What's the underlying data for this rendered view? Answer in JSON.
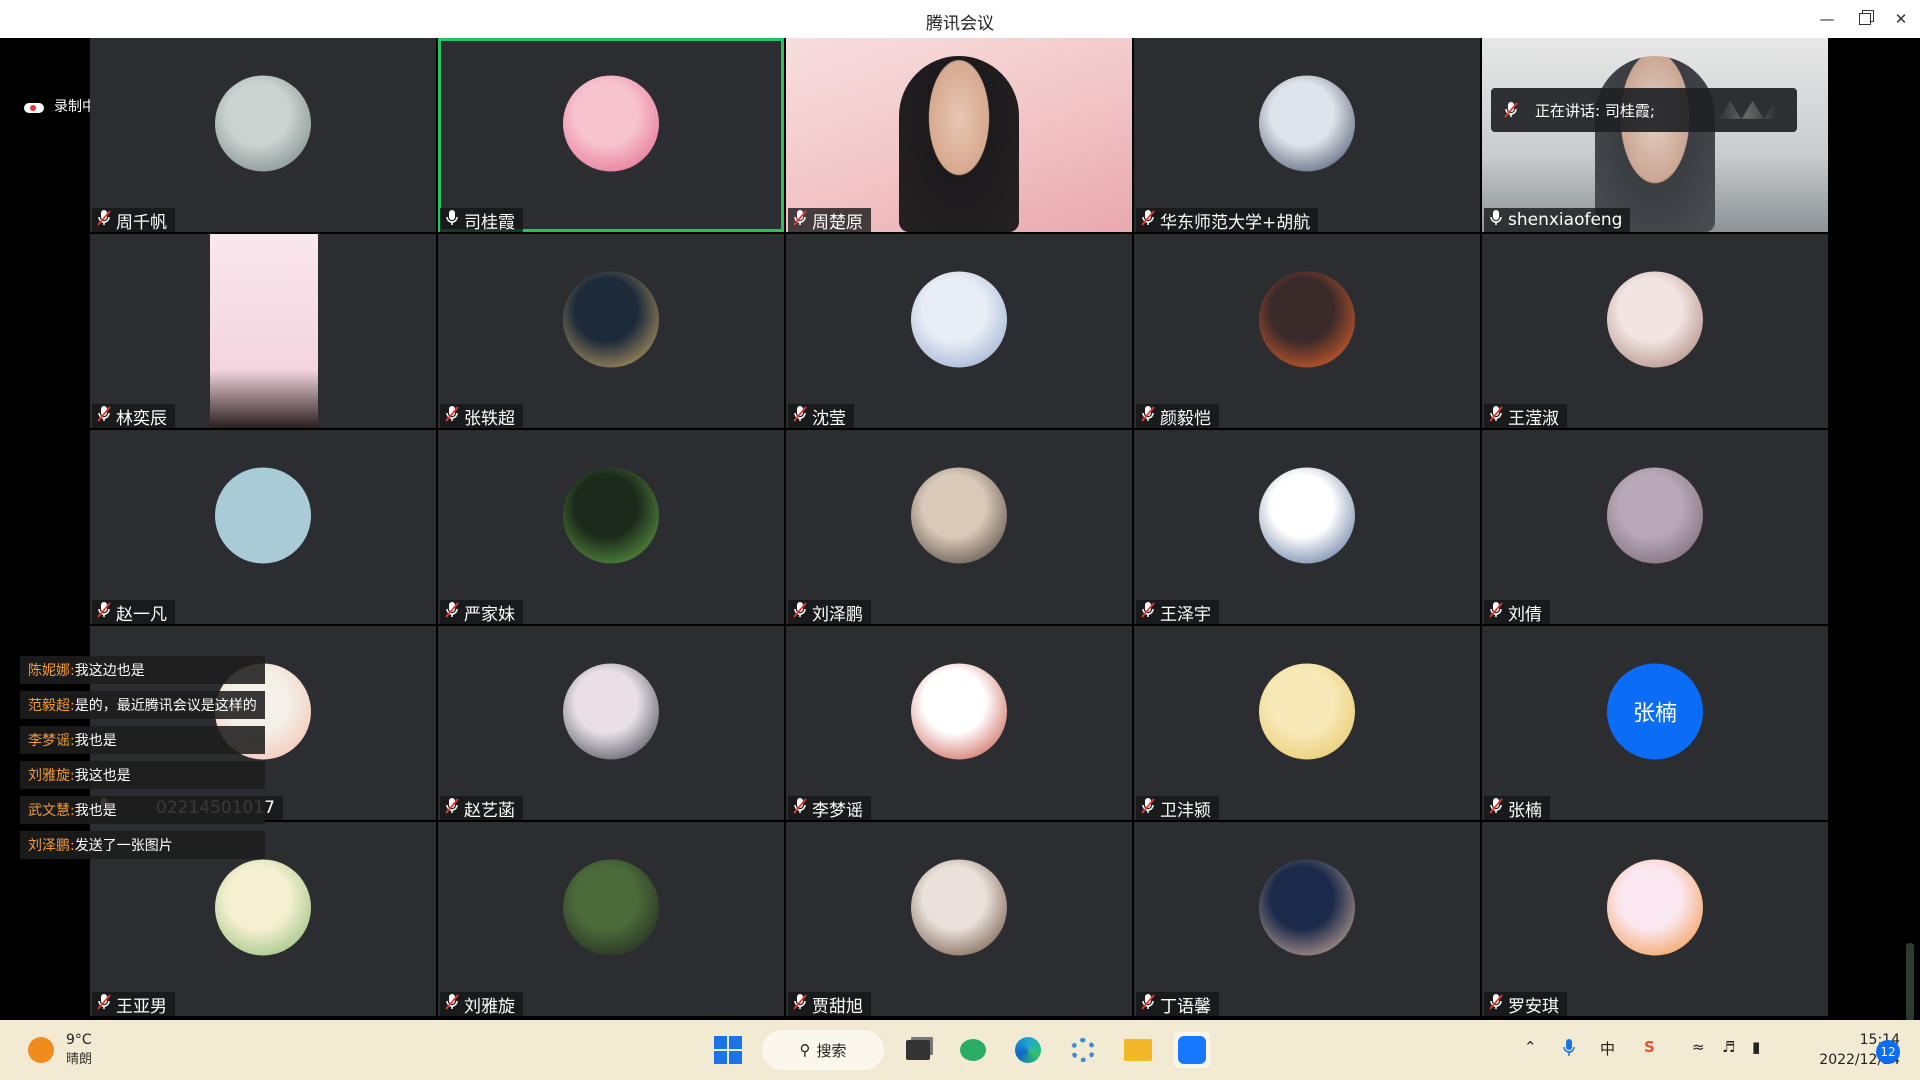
{
  "window": {
    "title": "腾讯会议"
  },
  "recording": {
    "label": "录制中"
  },
  "speaking": {
    "label": "正在讲话: 司桂霞;"
  },
  "participants": [
    {
      "name": "周千帆",
      "muted": true,
      "avatar_colors": [
        "#c9d3d0",
        "#6f7c7a"
      ]
    },
    {
      "name": "司桂霞",
      "muted": false,
      "active": true,
      "avatar_colors": [
        "#f6c3cf",
        "#e35d84"
      ]
    },
    {
      "name": "周楚原",
      "muted": true,
      "video": true
    },
    {
      "name": "华东师范大学+胡航",
      "muted": true,
      "avatar_colors": [
        "#dfe4ea",
        "#2d3a56"
      ]
    },
    {
      "name": "shenxiaofeng",
      "muted": false,
      "video": true
    },
    {
      "name": "林奕辰",
      "muted": true,
      "portrait": true
    },
    {
      "name": "张轶超",
      "muted": true,
      "avatar_colors": [
        "#1c2a3a",
        "#d9b36a"
      ]
    },
    {
      "name": "沈莹",
      "muted": true,
      "avatar_colors": [
        "#e9eef6",
        "#8aa0c8"
      ]
    },
    {
      "name": "颜毅恺",
      "muted": true,
      "avatar_colors": [
        "#3a2a2a",
        "#ff6a2a"
      ]
    },
    {
      "name": "王滢淑",
      "muted": true,
      "avatar_colors": [
        "#f1e4e1",
        "#a0756c"
      ]
    },
    {
      "name": "赵一凡",
      "muted": true,
      "avatar_colors": [
        "#a8cbd6",
        "#a8cbd6"
      ]
    },
    {
      "name": "严家妹",
      "muted": true,
      "avatar_colors": [
        "#1c2a1c",
        "#6bb04a"
      ]
    },
    {
      "name": "刘泽鹏",
      "muted": true,
      "avatar_colors": [
        "#d9c9b8",
        "#3a2f2a"
      ]
    },
    {
      "name": "王泽宇",
      "muted": true,
      "avatar_colors": [
        "#ffffff",
        "#3d5a8a"
      ]
    },
    {
      "name": "刘倩",
      "muted": true,
      "avatar_colors": [
        "#b9a9b6",
        "#6d5a6a"
      ]
    },
    {
      "name": "",
      "muted": true,
      "avatar_colors": [
        "#f4efe7",
        "#f3b9a6"
      ]
    },
    {
      "name": "赵艺菡",
      "muted": true,
      "avatar_colors": [
        "#e8e0e6",
        "#2b2b3a"
      ]
    },
    {
      "name": "李梦谣",
      "muted": true,
      "avatar_colors": [
        "#ffffff",
        "#c0392b"
      ]
    },
    {
      "name": "卫沣颍",
      "muted": true,
      "avatar_colors": [
        "#f7e9b8",
        "#e4c15a"
      ]
    },
    {
      "name": "张楠",
      "muted": true,
      "text_avatar": "张楠"
    },
    {
      "name": "王亚男",
      "muted": true,
      "avatar_colors": [
        "#f6f0d2",
        "#7fb36a"
      ]
    },
    {
      "name": "刘雅旋",
      "muted": true,
      "avatar_colors": [
        "#4b6b3a",
        "#1b1b1b"
      ]
    },
    {
      "name": "贾甜旭",
      "muted": true,
      "avatar_colors": [
        "#e9e1da",
        "#5a3a2a"
      ]
    },
    {
      "name": "丁语馨",
      "muted": true,
      "avatar_colors": [
        "#1b2a4a",
        "#e8c0a6"
      ]
    },
    {
      "name": "罗安琪",
      "muted": true,
      "avatar_colors": [
        "#fbe7ef",
        "#f08a2e"
      ]
    }
  ],
  "chat": [
    {
      "who": "陈妮娜:",
      "msg": "我这边也是"
    },
    {
      "who": "范毅超:",
      "msg": "是的，最近腾讯会议是这样的"
    },
    {
      "who": "李梦谣:",
      "msg": "我也是"
    },
    {
      "who": "刘雅旋:",
      "msg": "我这也是"
    },
    {
      "who": "武文慧:",
      "msg": "我也是"
    },
    {
      "who": "刘泽鹏:",
      "msg": "发送了一张图片"
    }
  ],
  "tile_overlap_text": "02214501017",
  "taskbar": {
    "weather_temp": "9°C",
    "weather_desc": "晴朗",
    "search_label": "搜索",
    "time": "15:14",
    "date": "2022/12/14",
    "notification_count": "12"
  }
}
